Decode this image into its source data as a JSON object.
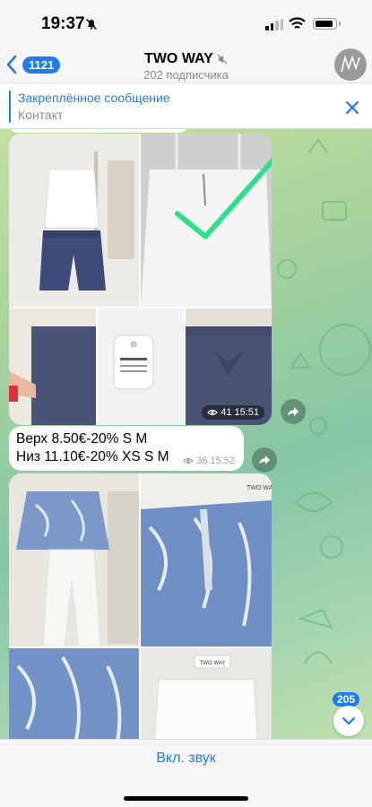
{
  "status_bar": {
    "time": "19:37"
  },
  "header": {
    "back_count": "1121",
    "channel_name": "TWO WAY",
    "subscribers": "202 подписчика"
  },
  "pinned": {
    "title": "Закреплённое сообщение",
    "text": "Контакт"
  },
  "messages": {
    "album1": {
      "views": "41",
      "time": "15:51"
    },
    "text_message": {
      "line1": "Верх 8.50€-20% S M",
      "line2": "Низ 11.10€-20% XS S M",
      "views": "36",
      "time": "15:52"
    },
    "album2_label": "TWO WAY"
  },
  "scroll": {
    "unread_count": "205"
  },
  "bottom": {
    "sound_button": "Вкл. звук"
  },
  "colors": {
    "accent": "#1d7cf2",
    "check": "#2fe08a"
  }
}
